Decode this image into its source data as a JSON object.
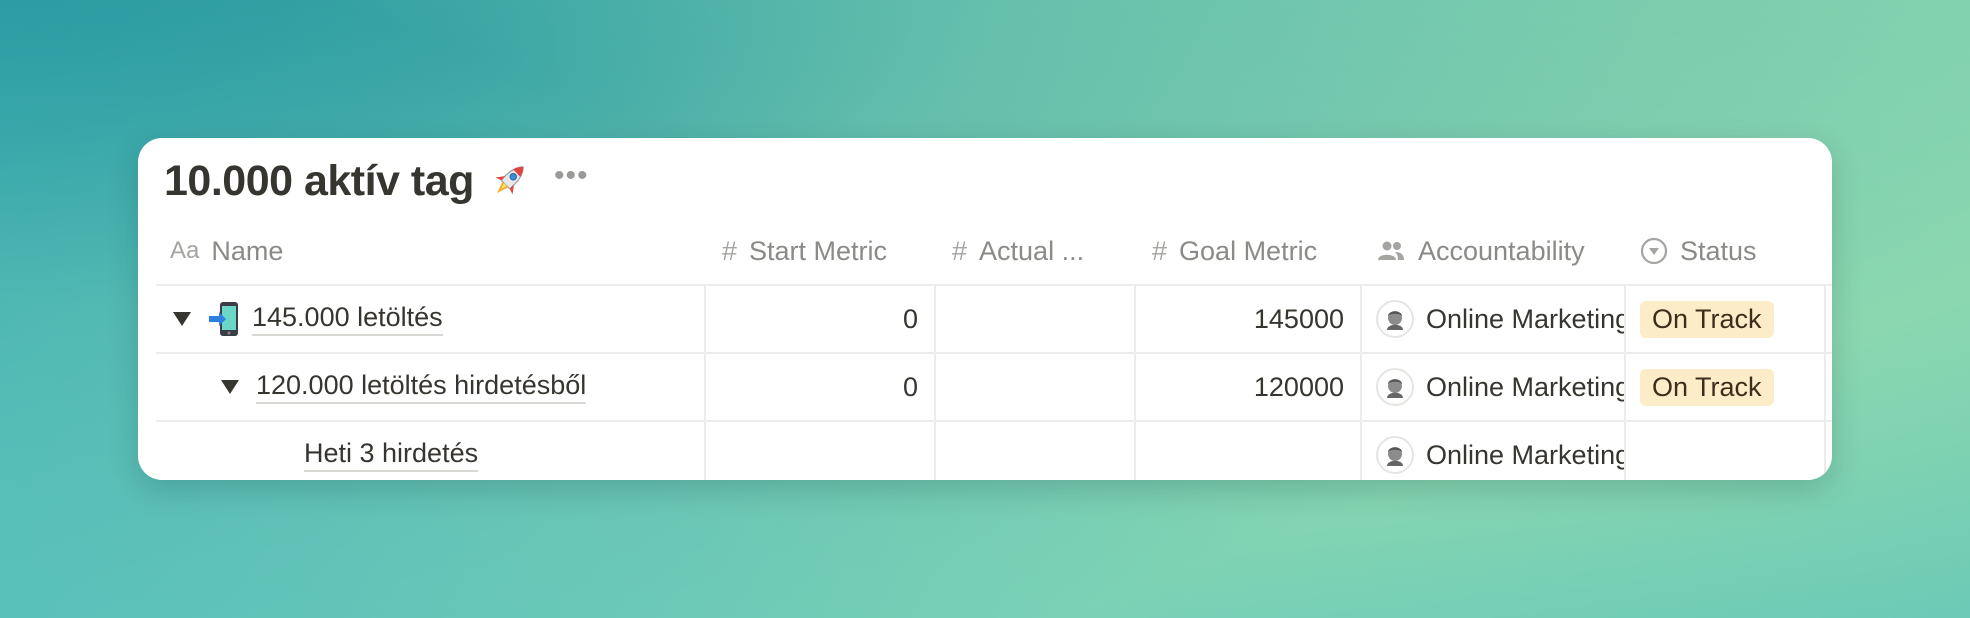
{
  "database": {
    "title": "10.000 aktív tag",
    "title_icon": "rocket-emoji",
    "more_label": "•••"
  },
  "columns": [
    {
      "label": "Name",
      "icon": "text-aa-icon"
    },
    {
      "label": "Start Metric",
      "icon": "hash-icon"
    },
    {
      "label": "Actual ...",
      "icon": "hash-icon"
    },
    {
      "label": "Goal Metric",
      "icon": "hash-icon"
    },
    {
      "label": "Accountability",
      "icon": "people-icon"
    },
    {
      "label": "Status",
      "icon": "status-icon"
    }
  ],
  "rows": [
    {
      "level": 0,
      "expanded": true,
      "icon": "mobile-phone-arrow-emoji",
      "name": "145.000 letöltés",
      "start_metric": "0",
      "actual": "",
      "goal_metric": "145000",
      "accountability": "Online Marketing",
      "status": "On Track"
    },
    {
      "level": 1,
      "expanded": true,
      "icon": "",
      "name": "120.000 letöltés hirdetésből",
      "start_metric": "0",
      "actual": "",
      "goal_metric": "120000",
      "accountability": "Online Marketing",
      "status": "On Track"
    },
    {
      "level": 2,
      "expanded": false,
      "icon": "",
      "name": "Heti 3 hirdetés",
      "start_metric": "",
      "actual": "",
      "goal_metric": "",
      "accountability": "Online Marketing",
      "status": ""
    }
  ],
  "colors": {
    "status_on_track_bg": "#fdecc8",
    "status_on_track_text": "#402c1b",
    "text": "#37352f",
    "muted": "#8a8a86"
  }
}
